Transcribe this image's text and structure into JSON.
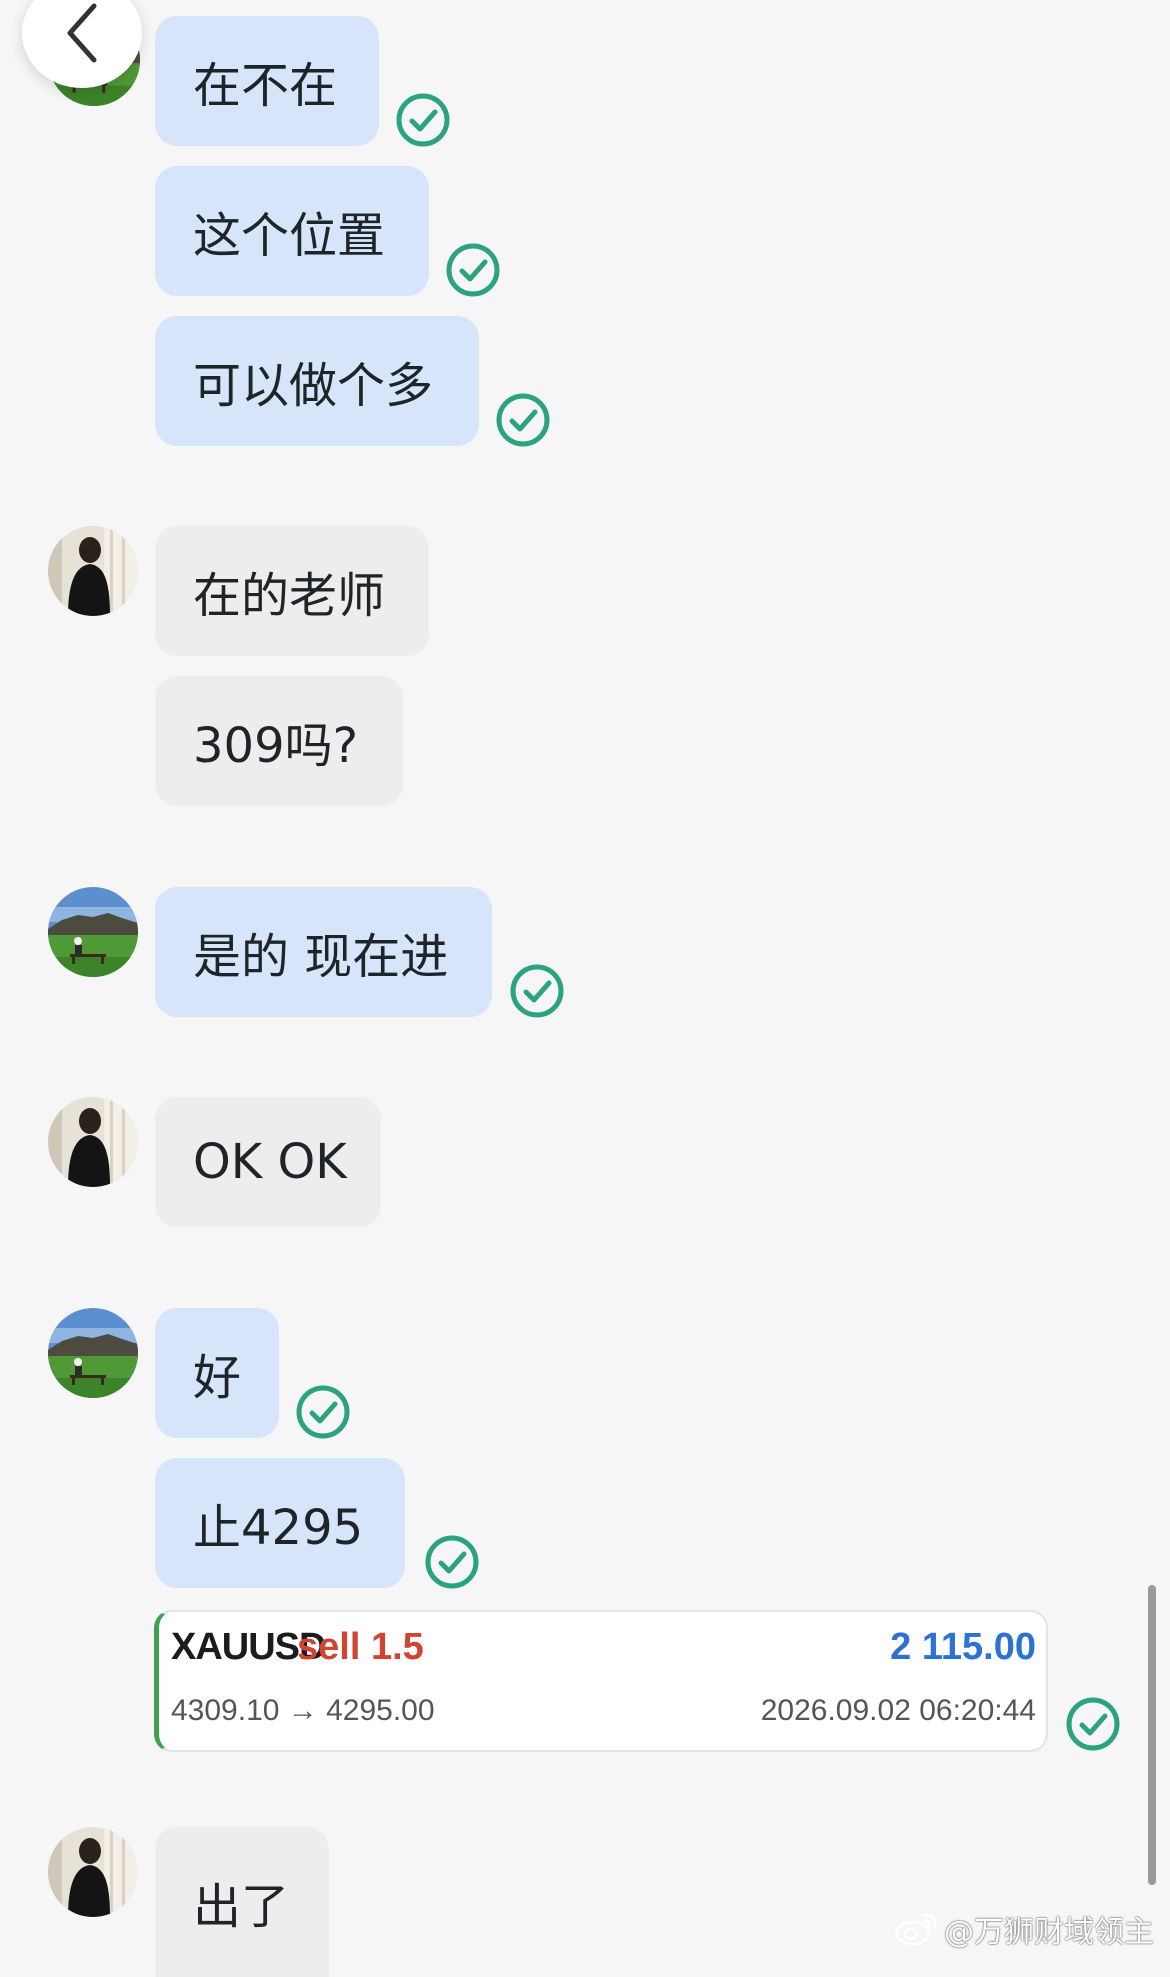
{
  "messages": [
    {
      "text": "在不在"
    },
    {
      "text": "这个位置"
    },
    {
      "text": "可以做个多"
    },
    {
      "text": "在的老师"
    },
    {
      "text": "309吗?"
    },
    {
      "text": "是的 现在进"
    },
    {
      "text": "OK OK"
    },
    {
      "text": "好"
    },
    {
      "text": "止4295"
    },
    {
      "text": "出了"
    }
  ],
  "trade_card": {
    "symbol": "XAUUSD",
    "side": "sell 1.5",
    "profit": "2 115.00",
    "price_range": "4309.10 → 4295.00",
    "timestamp": "2026.09.02 06:20:44"
  },
  "watermark": {
    "text": "@万狮财域领主",
    "icon": "weibo-icon"
  },
  "colors": {
    "outgoing_bubble": "#d7e5fb",
    "incoming_bubble": "#ededed",
    "read_check": "#2ba382",
    "trade_sell": "#cf4532",
    "trade_profit": "#2b72d4"
  },
  "icons": {
    "back": "chevron-left-icon",
    "read_receipt": "check-circle-icon"
  }
}
